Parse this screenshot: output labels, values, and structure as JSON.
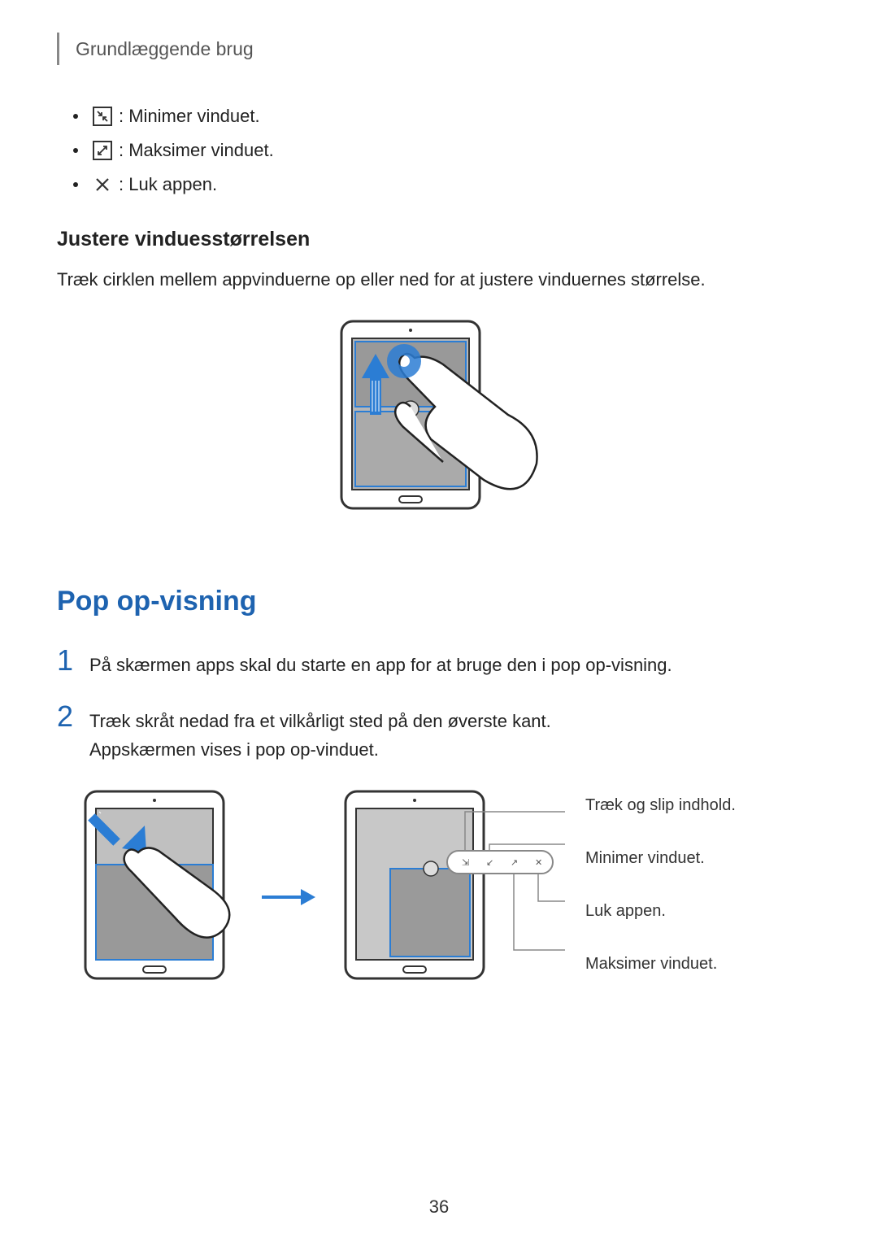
{
  "header": "Grundlæggende brug",
  "icons": [
    {
      "glyph": "↙",
      "boxed": true,
      "label": ": Minimer vinduet."
    },
    {
      "glyph": "↗",
      "boxed": true,
      "label": ": Maksimer vinduet."
    },
    {
      "glyph": "✕",
      "boxed": false,
      "label": ": Luk appen."
    }
  ],
  "subheading": "Justere vinduesstørrelsen",
  "subtext": "Træk cirklen mellem appvinduerne op eller ned for at justere vinduernes størrelse.",
  "main_heading": "Pop op-visning",
  "steps": [
    {
      "num": "1",
      "text": "På skærmen apps skal du starte en app for at bruge den i pop op-visning."
    },
    {
      "num": "2",
      "text": "Træk skråt nedad fra et vilkårligt sted på den øverste kant.\nAppskærmen vises i pop op-vinduet."
    }
  ],
  "callouts": [
    "Træk og slip indhold.",
    "Minimer vinduet.",
    "Luk appen.",
    "Maksimer vinduet."
  ],
  "page_num": "36"
}
